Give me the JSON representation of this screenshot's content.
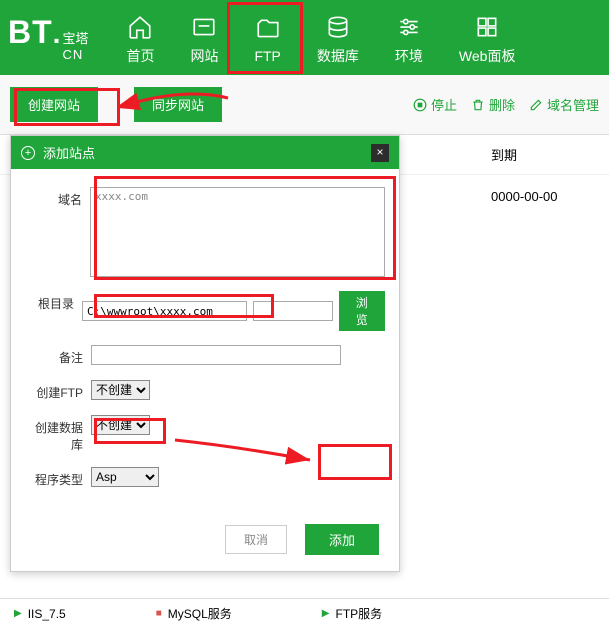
{
  "logo": {
    "bt": "BT",
    "dot": ".",
    "cn_chars": "宝塔",
    "en": "CN"
  },
  "nav": {
    "home": "首页",
    "site": "网站",
    "ftp": "FTP",
    "db": "数据库",
    "env": "环境",
    "web": "Web面板"
  },
  "toolbar": {
    "create": "创建网站",
    "sync": "同步网站",
    "stop": "停止",
    "delete": "删除",
    "domain_mgmt": "域名管理"
  },
  "table": {
    "expiry_header": "到期",
    "expiry_value": "0000-00-00"
  },
  "modal": {
    "title": "添加站点",
    "labels": {
      "domain": "域名",
      "root": "根目录",
      "note": "备注",
      "ftp": "创建FTP",
      "db": "创建数据库",
      "type": "程序类型"
    },
    "values": {
      "domain": "xxxx.com",
      "root": "C:\\wwwroot\\xxxx.com",
      "ftp_opt": "不创建",
      "db_opt": "不创建",
      "type_opt": "Asp"
    },
    "buttons": {
      "browse": "浏览",
      "cancel": "取消",
      "add": "添加"
    }
  },
  "status": {
    "iis": "IIS_7.5",
    "mysql": "MySQL服务",
    "ftp": "FTP服务"
  }
}
